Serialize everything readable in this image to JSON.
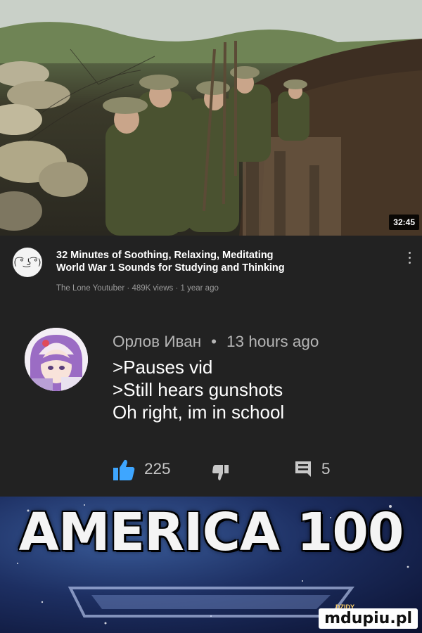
{
  "video": {
    "duration": "32:45",
    "title_line1": "32 Minutes of Soothing, Relaxing, Meditating",
    "title_line2": "World War 1 Sounds for Studying and Thinking",
    "channel": "The Lone Youtuber",
    "views": "489K views",
    "age": "1 year ago",
    "channel_avatar_glyph": "( ͡° ͜ʖ ͡°)",
    "separator": "·"
  },
  "comment": {
    "author": "Орлов Иван",
    "bullet": "•",
    "time": "13 hours ago",
    "lines": [
      ">Pauses vid",
      ">Still hears gunshots",
      "Oh right, im in school"
    ],
    "likes": "225",
    "replies": "5"
  },
  "meme": {
    "caption": "AMERICA 100",
    "small_logo": "DZIDY",
    "watermark": "mdupiu.pl"
  },
  "icons": {
    "like": "thumbs-up-icon",
    "dislike": "thumbs-down-icon",
    "reply": "comment-icon",
    "menu": "more-vertical-icon"
  },
  "colors": {
    "background": "#222222",
    "like_blue": "#3ea6ff",
    "meta_gray": "#9a9a9a"
  }
}
